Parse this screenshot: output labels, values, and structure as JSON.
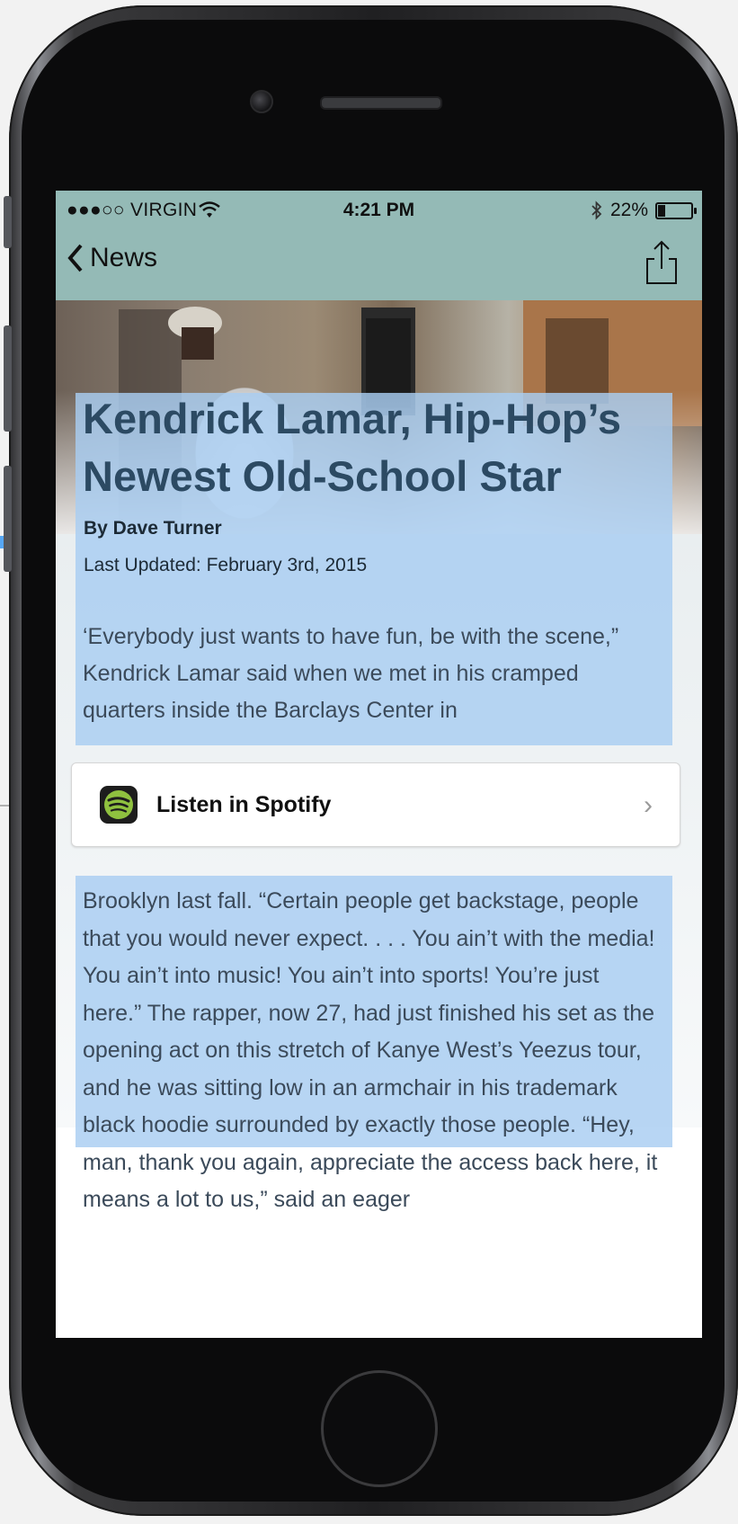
{
  "status_bar": {
    "carrier": "●●●○○ VIRGIN",
    "time": "4:21 PM",
    "bluetooth_icon": "bluetooth-icon",
    "battery": "22%",
    "battery_level": 0.22
  },
  "nav": {
    "back_label": "News",
    "share_icon": "share-icon"
  },
  "article": {
    "title": "Kendrick Lamar, Hip-Hop’s Newest Old-School Star",
    "byline": "By Dave Turner",
    "updated": "Last Updated: February 3rd, 2015",
    "paragraph1": "‘Everybody just wants to have fun, be with the scene,” Kendrick Lamar said when we met in his cramped quarters inside the Barclays Center in",
    "paragraph2": "Brooklyn last fall. “Certain people get backstage, people that you would never expect. . . . You ain’t with the media! You ain’t into music! You ain’t into sports! You’re just here.” The rapper, now 27, had just finished his set as the opening act on this stretch of Kanye West’s Yeezus tour, and he was sitting low in an armchair in his trademark black hoodie surrounded by exactly those people. “Hey, man, thank you again, appreciate the access back here, it means a lot to us,” said an eager"
  },
  "spotify": {
    "label": "Listen in Spotify",
    "icon": "spotify-icon",
    "chevron": "›"
  },
  "colors": {
    "nav_bg": "#94bab6",
    "highlight": "#a8cdf2",
    "title_color": "#2c4a63",
    "callout": "#56a7f4"
  }
}
